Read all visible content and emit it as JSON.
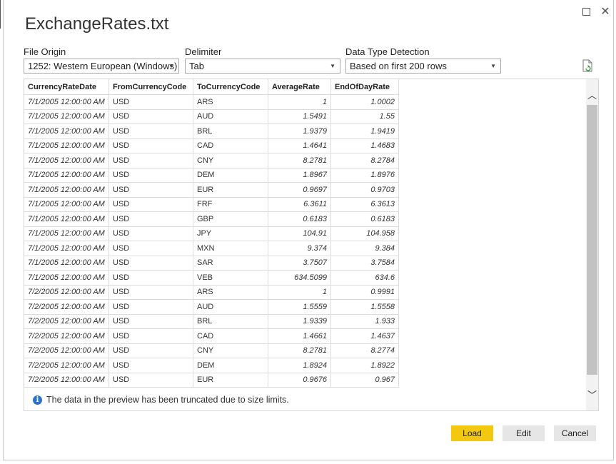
{
  "window": {
    "title": "ExchangeRates.txt"
  },
  "options": {
    "file_origin": {
      "label": "File Origin",
      "value": "1252: Western European (Windows)"
    },
    "delimiter": {
      "label": "Delimiter",
      "value": "Tab"
    },
    "data_type_detection": {
      "label": "Data Type Detection",
      "value": "Based on first 200 rows"
    }
  },
  "table": {
    "columns": [
      "CurrencyRateDate",
      "FromCurrencyCode",
      "ToCurrencyCode",
      "AverageRate",
      "EndOfDayRate"
    ],
    "rows": [
      [
        "7/1/2005 12:00:00 AM",
        "USD",
        "ARS",
        "1",
        "1.0002"
      ],
      [
        "7/1/2005 12:00:00 AM",
        "USD",
        "AUD",
        "1.5491",
        "1.55"
      ],
      [
        "7/1/2005 12:00:00 AM",
        "USD",
        "BRL",
        "1.9379",
        "1.9419"
      ],
      [
        "7/1/2005 12:00:00 AM",
        "USD",
        "CAD",
        "1.4641",
        "1.4683"
      ],
      [
        "7/1/2005 12:00:00 AM",
        "USD",
        "CNY",
        "8.2781",
        "8.2784"
      ],
      [
        "7/1/2005 12:00:00 AM",
        "USD",
        "DEM",
        "1.8967",
        "1.8976"
      ],
      [
        "7/1/2005 12:00:00 AM",
        "USD",
        "EUR",
        "0.9697",
        "0.9703"
      ],
      [
        "7/1/2005 12:00:00 AM",
        "USD",
        "FRF",
        "6.3611",
        "6.3613"
      ],
      [
        "7/1/2005 12:00:00 AM",
        "USD",
        "GBP",
        "0.6183",
        "0.6183"
      ],
      [
        "7/1/2005 12:00:00 AM",
        "USD",
        "JPY",
        "104.91",
        "104.958"
      ],
      [
        "7/1/2005 12:00:00 AM",
        "USD",
        "MXN",
        "9.374",
        "9.384"
      ],
      [
        "7/1/2005 12:00:00 AM",
        "USD",
        "SAR",
        "3.7507",
        "3.7584"
      ],
      [
        "7/1/2005 12:00:00 AM",
        "USD",
        "VEB",
        "634.5099",
        "634.6"
      ],
      [
        "7/2/2005 12:00:00 AM",
        "USD",
        "ARS",
        "1",
        "0.9991"
      ],
      [
        "7/2/2005 12:00:00 AM",
        "USD",
        "AUD",
        "1.5559",
        "1.5558"
      ],
      [
        "7/2/2005 12:00:00 AM",
        "USD",
        "BRL",
        "1.9339",
        "1.933"
      ],
      [
        "7/2/2005 12:00:00 AM",
        "USD",
        "CAD",
        "1.4661",
        "1.4637"
      ],
      [
        "7/2/2005 12:00:00 AM",
        "USD",
        "CNY",
        "8.2781",
        "8.2774"
      ],
      [
        "7/2/2005 12:00:00 AM",
        "USD",
        "DEM",
        "1.8924",
        "1.8922"
      ],
      [
        "7/2/2005 12:00:00 AM",
        "USD",
        "EUR",
        "0.9676",
        "0.967"
      ]
    ]
  },
  "notice": "The data in the preview has been truncated due to size limits.",
  "buttons": {
    "load": "Load",
    "edit": "Edit",
    "cancel": "Cancel"
  },
  "colors": {
    "load_button": "#f2c811",
    "info_icon": "#2b73c6"
  }
}
